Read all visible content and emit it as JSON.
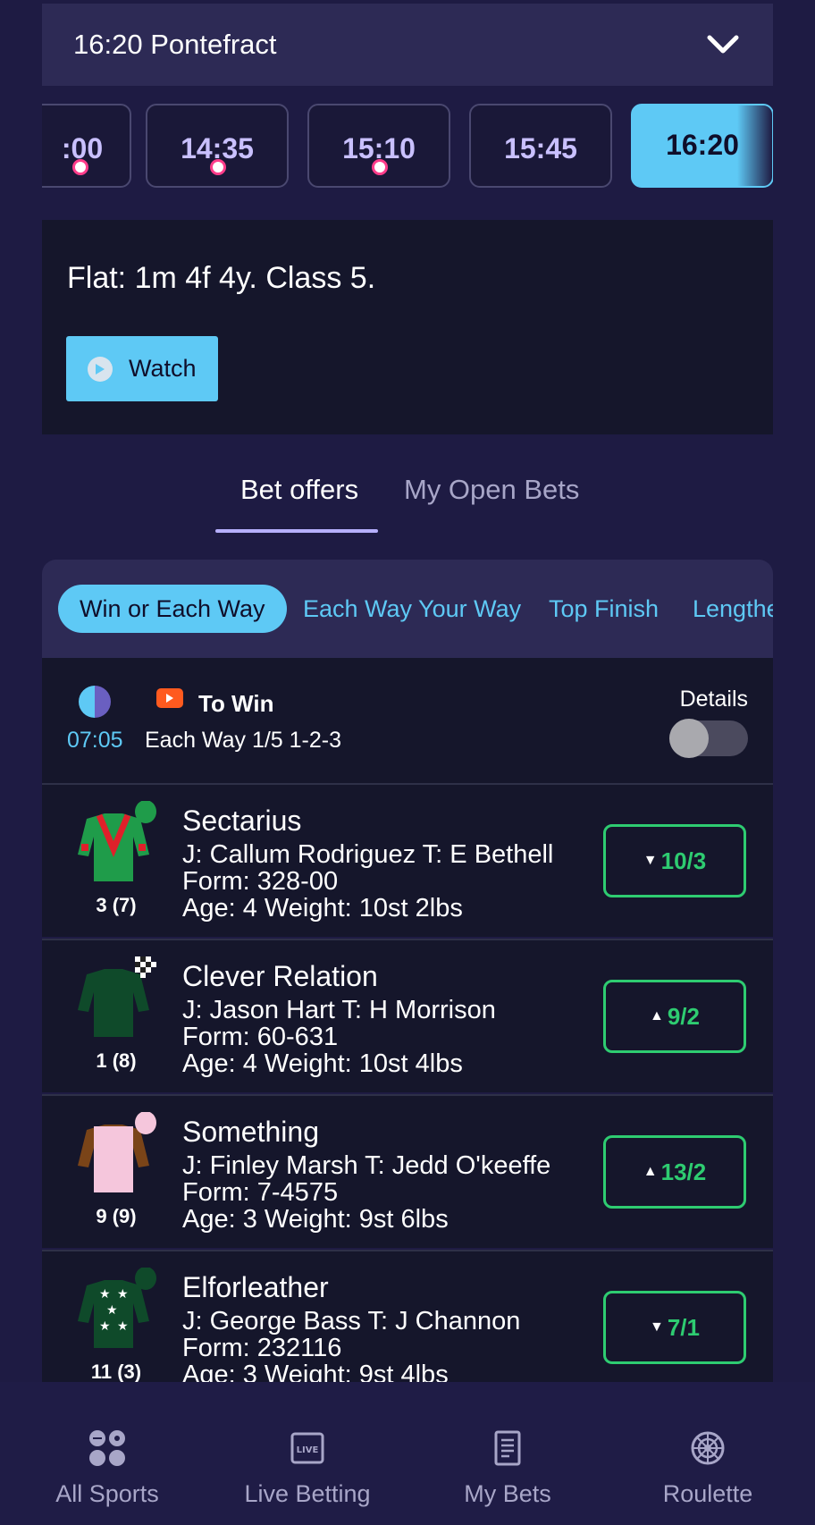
{
  "race_selector": {
    "title": "16:20 Pontefract"
  },
  "times": [
    {
      "label": ":00",
      "has_dot": true,
      "active": false
    },
    {
      "label": "14:35",
      "has_dot": true,
      "active": false
    },
    {
      "label": "15:10",
      "has_dot": true,
      "active": false
    },
    {
      "label": "15:45",
      "has_dot": false,
      "active": false
    },
    {
      "label": "16:20",
      "has_dot": false,
      "active": true
    }
  ],
  "race_info": {
    "description": "Flat: 1m 4f 4y. Class 5.",
    "watch_label": "Watch"
  },
  "tabs": {
    "bet_offers": "Bet offers",
    "my_open_bets": "My Open Bets"
  },
  "markets": [
    "Win or Each Way",
    "Each Way Your Way",
    "Top Finish",
    "Lengthe"
  ],
  "market_header": {
    "countdown": "07:05",
    "title": "To Win",
    "each_way": "Each Way 1/5 1-2-3",
    "details_label": "Details"
  },
  "runners": [
    {
      "name": "Sectarius",
      "number": "3 (7)",
      "jockey_label": "J:",
      "jockey": "Callum Rodriguez",
      "trainer_label": "T:",
      "trainer": "E Bethell",
      "form": "Form: 328-00",
      "age_weight": "Age: 4 Weight: 10st 2lbs",
      "odds": "10/3",
      "trend": "down"
    },
    {
      "name": "Clever Relation",
      "number": "1 (8)",
      "jockey_label": "J:",
      "jockey": "Jason Hart",
      "trainer_label": "T:",
      "trainer": "H Morrison",
      "form": "Form: 60-631",
      "age_weight": "Age: 4 Weight: 10st 4lbs",
      "odds": "9/2",
      "trend": "up"
    },
    {
      "name": "Something",
      "number": "9 (9)",
      "jockey_label": "J:",
      "jockey": "Finley Marsh",
      "trainer_label": "T:",
      "trainer": "Jedd O'keeffe",
      "form": "Form: 7-4575",
      "age_weight": "Age: 3 Weight: 9st 6lbs",
      "odds": "13/2",
      "trend": "up"
    },
    {
      "name": "Elforleather",
      "number": "11 (3)",
      "jockey_label": "J:",
      "jockey": "George Bass",
      "trainer_label": "T:",
      "trainer": "J Channon",
      "form": "Form: 232116",
      "age_weight": "Age: 3 Weight: 9st 4lbs",
      "odds": "7/1",
      "trend": "down"
    }
  ],
  "bottom_nav": [
    {
      "label": "All Sports",
      "icon": "all-sports-icon"
    },
    {
      "label": "Live Betting",
      "icon": "live-icon"
    },
    {
      "label": "My Bets",
      "icon": "betslip-icon"
    },
    {
      "label": "Roulette",
      "icon": "roulette-icon"
    }
  ],
  "colors": {
    "accent": "#5ec9f5",
    "odds_green": "#2ecc71",
    "background": "#1e1b43",
    "card": "#15162b"
  }
}
